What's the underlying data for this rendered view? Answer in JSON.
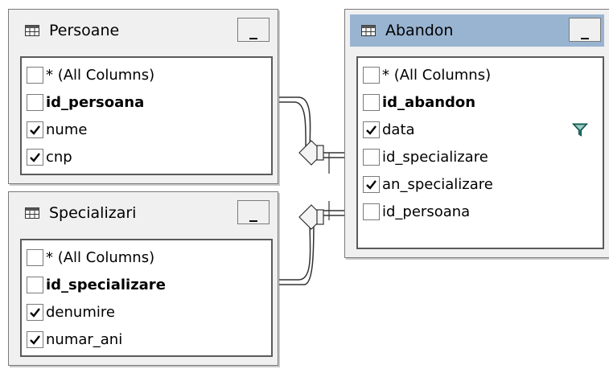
{
  "tables": [
    {
      "title": "Persoane",
      "minimize_label": "_",
      "columns": [
        {
          "name": "* (All Columns)",
          "checked": false,
          "pk": false,
          "filter": false
        },
        {
          "name": "id_persoana",
          "checked": false,
          "pk": true,
          "filter": false
        },
        {
          "name": "nume",
          "checked": true,
          "pk": false,
          "filter": false
        },
        {
          "name": "cnp",
          "checked": true,
          "pk": false,
          "filter": false
        }
      ]
    },
    {
      "title": "Specializari",
      "minimize_label": "_",
      "columns": [
        {
          "name": "* (All Columns)",
          "checked": false,
          "pk": false,
          "filter": false
        },
        {
          "name": "id_specializare",
          "checked": false,
          "pk": true,
          "filter": false
        },
        {
          "name": "denumire",
          "checked": true,
          "pk": false,
          "filter": false
        },
        {
          "name": "numar_ani",
          "checked": true,
          "pk": false,
          "filter": false
        }
      ]
    },
    {
      "title": "Abandon",
      "minimize_label": "_",
      "columns": [
        {
          "name": "* (All Columns)",
          "checked": false,
          "pk": false,
          "filter": false
        },
        {
          "name": "id_abandon",
          "checked": false,
          "pk": true,
          "filter": false
        },
        {
          "name": "data",
          "checked": true,
          "pk": false,
          "filter": true
        },
        {
          "name": "id_specializare",
          "checked": false,
          "pk": false,
          "filter": false
        },
        {
          "name": "an_specializare",
          "checked": true,
          "pk": false,
          "filter": false
        },
        {
          "name": "id_persoana",
          "checked": false,
          "pk": false,
          "filter": false
        }
      ]
    }
  ],
  "colors": {
    "active_header": "#99b4d1",
    "panel_bg": "#f0f0f0",
    "filter_icon": "#1e7a6e"
  }
}
